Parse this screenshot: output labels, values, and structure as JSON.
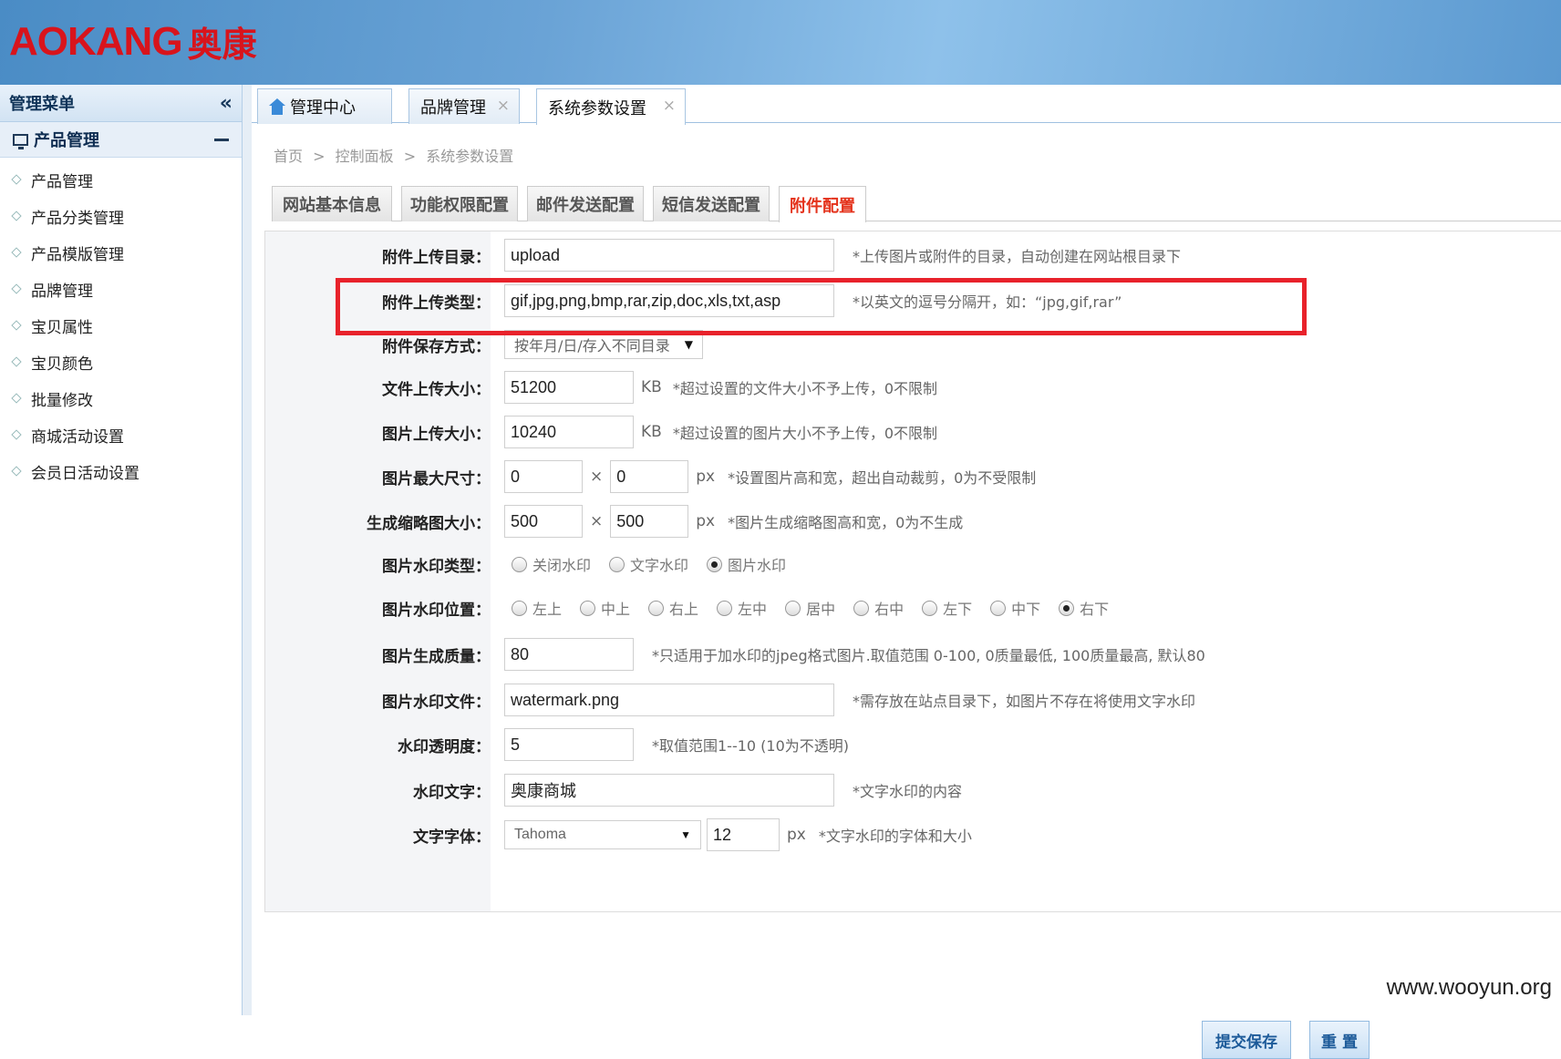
{
  "logo": {
    "en": "AOKANG",
    "cn": "奥康"
  },
  "sidebar": {
    "title": "管理菜单",
    "group": "产品管理",
    "items": [
      "产品管理",
      "产品分类管理",
      "产品模版管理",
      "品牌管理",
      "宝贝属性",
      "宝贝颜色",
      "批量修改",
      "商城活动设置",
      "会员日活动设置"
    ]
  },
  "tabs": [
    {
      "label": "管理中心"
    },
    {
      "label": "品牌管理",
      "close": "×"
    },
    {
      "label": "系统参数设置",
      "close": "×"
    }
  ],
  "breadcrumb": [
    "首页",
    ">",
    "控制面板",
    ">",
    "系统参数设置"
  ],
  "subtabs": [
    "网站基本信息",
    "功能权限配置",
    "邮件发送配置",
    "短信发送配置",
    "附件配置"
  ],
  "form": {
    "upload_dir": {
      "label": "附件上传目录：",
      "value": "upload",
      "hint": "*上传图片或附件的目录，自动创建在网站根目录下"
    },
    "upload_types": {
      "label": "附件上传类型：",
      "value": "gif,jpg,png,bmp,rar,zip,doc,xls,txt,asp",
      "hint": "*以英文的逗号分隔开，如：“jpg,gif,rar”"
    },
    "save_mode": {
      "label": "附件保存方式：",
      "value": "按年月/日/存入不同目录"
    },
    "file_size": {
      "label": "文件上传大小：",
      "value": "51200",
      "unit": "KB",
      "hint": "*超过设置的文件大小不予上传，0不限制"
    },
    "image_size": {
      "label": "图片上传大小：",
      "value": "10240",
      "unit": "KB",
      "hint": "*超过设置的图片大小不予上传，0不限制"
    },
    "max_dim": {
      "label": "图片最大尺寸：",
      "w": "0",
      "h": "0",
      "times": "×",
      "unit": "px",
      "hint": "*设置图片高和宽，超出自动裁剪，0为不受限制"
    },
    "thumb_dim": {
      "label": "生成缩略图大小：",
      "w": "500",
      "h": "500",
      "times": "×",
      "unit": "px",
      "hint": "*图片生成缩略图高和宽，0为不生成"
    },
    "wm_type": {
      "label": "图片水印类型：",
      "options": [
        "关闭水印",
        "文字水印",
        "图片水印"
      ],
      "selected": 2
    },
    "wm_pos": {
      "label": "图片水印位置：",
      "options": [
        "左上",
        "中上",
        "右上",
        "左中",
        "居中",
        "右中",
        "左下",
        "中下",
        "右下"
      ],
      "selected": 8
    },
    "quality": {
      "label": "图片生成质量：",
      "value": "80",
      "hint": "*只适用于加水印的jpeg格式图片.取值范围 0-100, 0质量最低, 100质量最高, 默认80"
    },
    "wm_file": {
      "label": "图片水印文件：",
      "value": "watermark.png",
      "hint": "*需存放在站点目录下，如图片不存在将使用文字水印"
    },
    "wm_alpha": {
      "label": "水印透明度：",
      "value": "5",
      "hint": "*取值范围1--10 (10为不透明)"
    },
    "wm_text": {
      "label": "水印文字：",
      "value": "奥康商城",
      "hint": "*文字水印的内容"
    },
    "wm_font": {
      "label": "文字字体：",
      "font": "Tahoma",
      "size": "12",
      "unit": "px",
      "hint": "*文字水印的字体和大小"
    }
  },
  "buttons": {
    "submit": "提交保存",
    "reset": "重 置"
  },
  "watermark": "www.wooyun.org",
  "colors": {
    "accent_red": "#e8222b",
    "brand_red": "#d8141c",
    "header_blue": "#4a8cc5"
  }
}
